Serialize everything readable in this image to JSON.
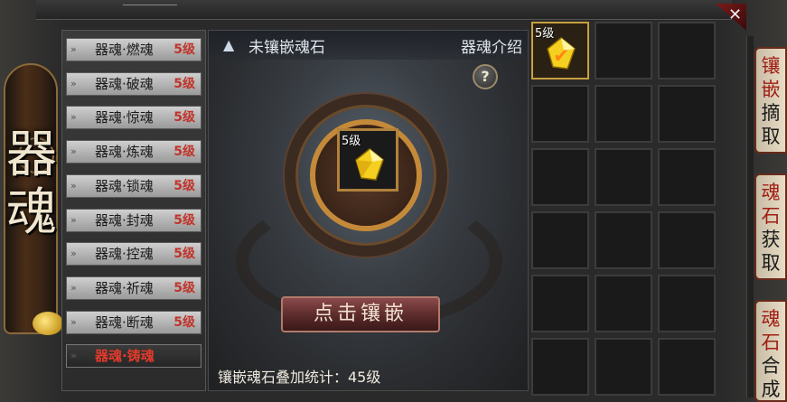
{
  "banner": {
    "title": "器魂"
  },
  "list": {
    "items": [
      {
        "label": "器魂·燃魂",
        "level": "5级",
        "active": false
      },
      {
        "label": "器魂·破魂",
        "level": "5级",
        "active": false
      },
      {
        "label": "器魂·惊魂",
        "level": "5级",
        "active": false
      },
      {
        "label": "器魂·炼魂",
        "level": "5级",
        "active": false
      },
      {
        "label": "器魂·锁魂",
        "level": "5级",
        "active": false
      },
      {
        "label": "器魂·封魂",
        "level": "5级",
        "active": false
      },
      {
        "label": "器魂·控魂",
        "level": "5级",
        "active": false
      },
      {
        "label": "器魂·祈魂",
        "level": "5级",
        "active": false
      },
      {
        "label": "器魂·断魂",
        "level": "5级",
        "active": false
      },
      {
        "label": "器魂·铸魂",
        "level": "",
        "active": true
      }
    ]
  },
  "center": {
    "title": "未镶嵌魂石",
    "intro_link": "器魂介绍",
    "help_icon": "?",
    "slot_level": "5级",
    "inlay_button": "点击镶嵌",
    "stat_text": "镶嵌魂石叠加统计：45级"
  },
  "grid": {
    "cells": [
      {
        "level": "5级",
        "filled": true,
        "checked": true
      },
      {
        "level": "",
        "filled": false
      },
      {
        "level": "",
        "filled": false
      },
      {
        "level": "",
        "filled": false
      },
      {
        "level": "",
        "filled": false
      },
      {
        "level": "",
        "filled": false
      },
      {
        "level": "",
        "filled": false
      },
      {
        "level": "",
        "filled": false
      },
      {
        "level": "",
        "filled": false
      },
      {
        "level": "",
        "filled": false
      },
      {
        "level": "",
        "filled": false
      },
      {
        "level": "",
        "filled": false
      },
      {
        "level": "",
        "filled": false
      },
      {
        "level": "",
        "filled": false
      },
      {
        "level": "",
        "filled": false
      },
      {
        "level": "",
        "filled": false
      },
      {
        "level": "",
        "filled": false
      },
      {
        "level": "",
        "filled": false
      }
    ]
  },
  "tabs": [
    {
      "top": "镶嵌",
      "bottom": "摘取"
    },
    {
      "top": "魂石",
      "bottom": "获取"
    },
    {
      "top": "魂石",
      "bottom": "合成"
    }
  ],
  "colors": {
    "level_red": "#c0342a",
    "active_red": "#e23a2a",
    "gold": "#c8a040",
    "gem": "#f5d020"
  },
  "icons": {
    "close": "close-icon",
    "help": "help-icon",
    "header": "soulstone-header-icon",
    "gem": "gem-icon",
    "check": "checkmark-icon"
  }
}
